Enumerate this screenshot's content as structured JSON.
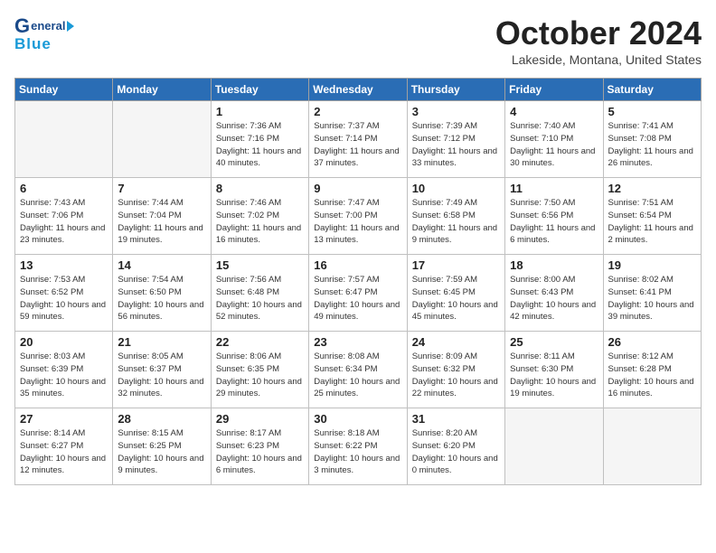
{
  "header": {
    "logo_general": "General",
    "logo_blue": "Blue",
    "title": "October 2024",
    "subtitle": "Lakeside, Montana, United States"
  },
  "weekdays": [
    "Sunday",
    "Monday",
    "Tuesday",
    "Wednesday",
    "Thursday",
    "Friday",
    "Saturday"
  ],
  "weeks": [
    [
      {
        "day": "",
        "empty": true
      },
      {
        "day": "",
        "empty": true
      },
      {
        "day": "1",
        "sunrise": "Sunrise: 7:36 AM",
        "sunset": "Sunset: 7:16 PM",
        "daylight": "Daylight: 11 hours and 40 minutes."
      },
      {
        "day": "2",
        "sunrise": "Sunrise: 7:37 AM",
        "sunset": "Sunset: 7:14 PM",
        "daylight": "Daylight: 11 hours and 37 minutes."
      },
      {
        "day": "3",
        "sunrise": "Sunrise: 7:39 AM",
        "sunset": "Sunset: 7:12 PM",
        "daylight": "Daylight: 11 hours and 33 minutes."
      },
      {
        "day": "4",
        "sunrise": "Sunrise: 7:40 AM",
        "sunset": "Sunset: 7:10 PM",
        "daylight": "Daylight: 11 hours and 30 minutes."
      },
      {
        "day": "5",
        "sunrise": "Sunrise: 7:41 AM",
        "sunset": "Sunset: 7:08 PM",
        "daylight": "Daylight: 11 hours and 26 minutes."
      }
    ],
    [
      {
        "day": "6",
        "sunrise": "Sunrise: 7:43 AM",
        "sunset": "Sunset: 7:06 PM",
        "daylight": "Daylight: 11 hours and 23 minutes."
      },
      {
        "day": "7",
        "sunrise": "Sunrise: 7:44 AM",
        "sunset": "Sunset: 7:04 PM",
        "daylight": "Daylight: 11 hours and 19 minutes."
      },
      {
        "day": "8",
        "sunrise": "Sunrise: 7:46 AM",
        "sunset": "Sunset: 7:02 PM",
        "daylight": "Daylight: 11 hours and 16 minutes."
      },
      {
        "day": "9",
        "sunrise": "Sunrise: 7:47 AM",
        "sunset": "Sunset: 7:00 PM",
        "daylight": "Daylight: 11 hours and 13 minutes."
      },
      {
        "day": "10",
        "sunrise": "Sunrise: 7:49 AM",
        "sunset": "Sunset: 6:58 PM",
        "daylight": "Daylight: 11 hours and 9 minutes."
      },
      {
        "day": "11",
        "sunrise": "Sunrise: 7:50 AM",
        "sunset": "Sunset: 6:56 PM",
        "daylight": "Daylight: 11 hours and 6 minutes."
      },
      {
        "day": "12",
        "sunrise": "Sunrise: 7:51 AM",
        "sunset": "Sunset: 6:54 PM",
        "daylight": "Daylight: 11 hours and 2 minutes."
      }
    ],
    [
      {
        "day": "13",
        "sunrise": "Sunrise: 7:53 AM",
        "sunset": "Sunset: 6:52 PM",
        "daylight": "Daylight: 10 hours and 59 minutes."
      },
      {
        "day": "14",
        "sunrise": "Sunrise: 7:54 AM",
        "sunset": "Sunset: 6:50 PM",
        "daylight": "Daylight: 10 hours and 56 minutes."
      },
      {
        "day": "15",
        "sunrise": "Sunrise: 7:56 AM",
        "sunset": "Sunset: 6:48 PM",
        "daylight": "Daylight: 10 hours and 52 minutes."
      },
      {
        "day": "16",
        "sunrise": "Sunrise: 7:57 AM",
        "sunset": "Sunset: 6:47 PM",
        "daylight": "Daylight: 10 hours and 49 minutes."
      },
      {
        "day": "17",
        "sunrise": "Sunrise: 7:59 AM",
        "sunset": "Sunset: 6:45 PM",
        "daylight": "Daylight: 10 hours and 45 minutes."
      },
      {
        "day": "18",
        "sunrise": "Sunrise: 8:00 AM",
        "sunset": "Sunset: 6:43 PM",
        "daylight": "Daylight: 10 hours and 42 minutes."
      },
      {
        "day": "19",
        "sunrise": "Sunrise: 8:02 AM",
        "sunset": "Sunset: 6:41 PM",
        "daylight": "Daylight: 10 hours and 39 minutes."
      }
    ],
    [
      {
        "day": "20",
        "sunrise": "Sunrise: 8:03 AM",
        "sunset": "Sunset: 6:39 PM",
        "daylight": "Daylight: 10 hours and 35 minutes."
      },
      {
        "day": "21",
        "sunrise": "Sunrise: 8:05 AM",
        "sunset": "Sunset: 6:37 PM",
        "daylight": "Daylight: 10 hours and 32 minutes."
      },
      {
        "day": "22",
        "sunrise": "Sunrise: 8:06 AM",
        "sunset": "Sunset: 6:35 PM",
        "daylight": "Daylight: 10 hours and 29 minutes."
      },
      {
        "day": "23",
        "sunrise": "Sunrise: 8:08 AM",
        "sunset": "Sunset: 6:34 PM",
        "daylight": "Daylight: 10 hours and 25 minutes."
      },
      {
        "day": "24",
        "sunrise": "Sunrise: 8:09 AM",
        "sunset": "Sunset: 6:32 PM",
        "daylight": "Daylight: 10 hours and 22 minutes."
      },
      {
        "day": "25",
        "sunrise": "Sunrise: 8:11 AM",
        "sunset": "Sunset: 6:30 PM",
        "daylight": "Daylight: 10 hours and 19 minutes."
      },
      {
        "day": "26",
        "sunrise": "Sunrise: 8:12 AM",
        "sunset": "Sunset: 6:28 PM",
        "daylight": "Daylight: 10 hours and 16 minutes."
      }
    ],
    [
      {
        "day": "27",
        "sunrise": "Sunrise: 8:14 AM",
        "sunset": "Sunset: 6:27 PM",
        "daylight": "Daylight: 10 hours and 12 minutes."
      },
      {
        "day": "28",
        "sunrise": "Sunrise: 8:15 AM",
        "sunset": "Sunset: 6:25 PM",
        "daylight": "Daylight: 10 hours and 9 minutes."
      },
      {
        "day": "29",
        "sunrise": "Sunrise: 8:17 AM",
        "sunset": "Sunset: 6:23 PM",
        "daylight": "Daylight: 10 hours and 6 minutes."
      },
      {
        "day": "30",
        "sunrise": "Sunrise: 8:18 AM",
        "sunset": "Sunset: 6:22 PM",
        "daylight": "Daylight: 10 hours and 3 minutes."
      },
      {
        "day": "31",
        "sunrise": "Sunrise: 8:20 AM",
        "sunset": "Sunset: 6:20 PM",
        "daylight": "Daylight: 10 hours and 0 minutes."
      },
      {
        "day": "",
        "empty": true
      },
      {
        "day": "",
        "empty": true
      }
    ]
  ]
}
